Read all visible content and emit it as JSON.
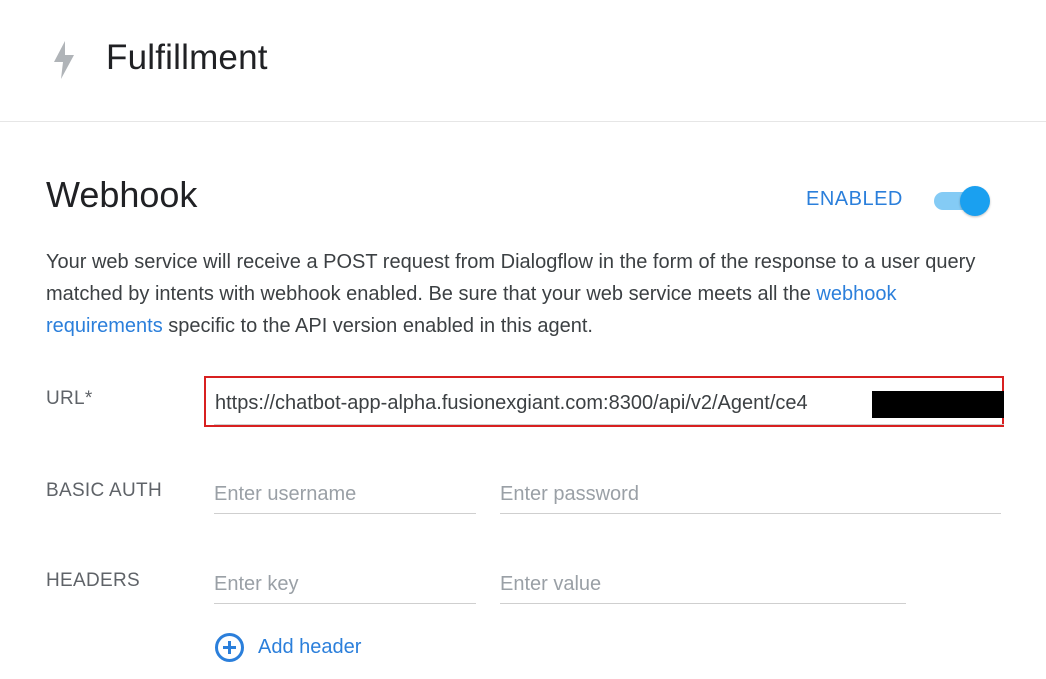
{
  "header": {
    "icon": "lightning-bolt-icon",
    "title": "Fulfillment"
  },
  "webhook": {
    "title": "Webhook",
    "status_label": "ENABLED",
    "toggle_on": true,
    "description_part1": "Your web service will receive a POST request from Dialogflow in the form of the response to a user query matched by intents with webhook enabled. Be sure that your web service meets all the ",
    "description_link": "webhook requirements",
    "description_part2": " specific to the API version enabled in this agent."
  },
  "url": {
    "label": "URL*",
    "value": "https://chatbot-app-alpha.fusionexgiant.com:8300/api/v2/Agent/ce4"
  },
  "basic_auth": {
    "label": "BASIC AUTH",
    "username_placeholder": "Enter username",
    "password_placeholder": "Enter password"
  },
  "headers": {
    "label": "HEADERS",
    "key_placeholder": "Enter key",
    "value_placeholder": "Enter value",
    "add_icon": "plus-circle-icon",
    "add_label": "Add header"
  },
  "colors": {
    "accent": "#2b7fdb",
    "toggle_thumb": "#1aa0f0",
    "toggle_track": "#84cbf5",
    "highlight_border": "#d82020"
  }
}
